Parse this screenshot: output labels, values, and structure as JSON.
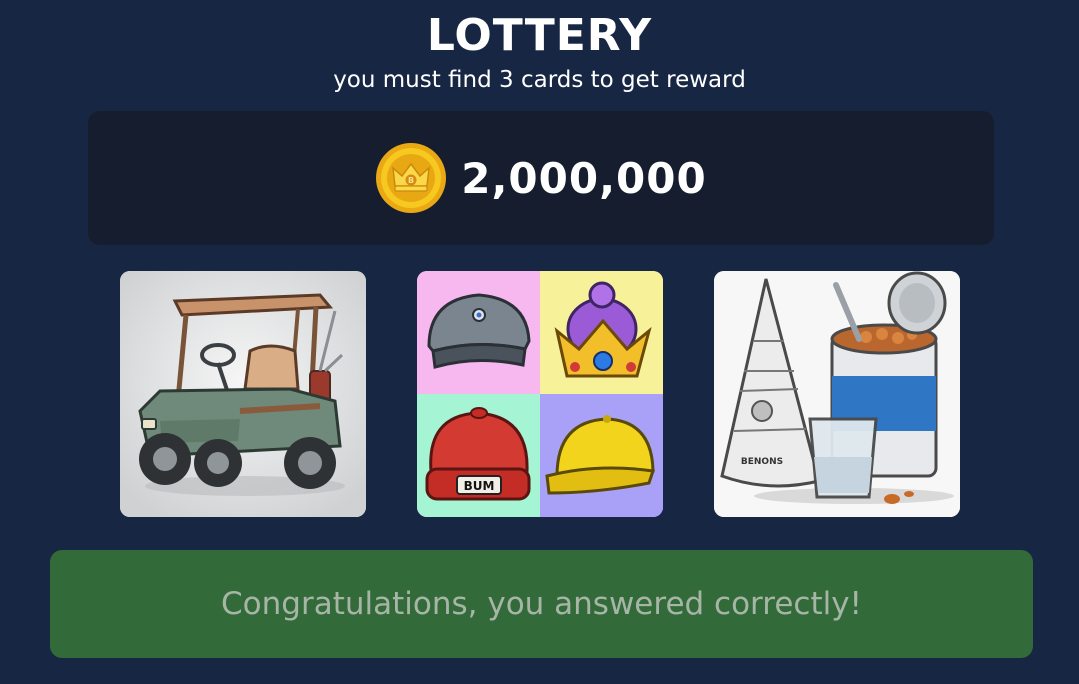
{
  "header": {
    "title": "LOTTERY",
    "subtitle": "you must find 3 cards to get reward"
  },
  "reward": {
    "amount": "2,000,000",
    "icon": "gold-coin-crown-icon"
  },
  "cards": [
    {
      "subject": "golf cart",
      "icon": "golf-cart-image"
    },
    {
      "subject": "hats",
      "icon": "hats-collage-image",
      "label": "BUM"
    },
    {
      "subject": "newspaper cone, beans can and glass",
      "icon": "newspaper-beans-glass-image",
      "label": "BENONS"
    }
  ],
  "result": {
    "message": "Congratulations, you answered correctly!"
  },
  "colors": {
    "background": "#172642",
    "panel": "#161d2e",
    "success": "#326b39",
    "success_text": "#a6b5a6",
    "coin": "#f2c21a"
  }
}
